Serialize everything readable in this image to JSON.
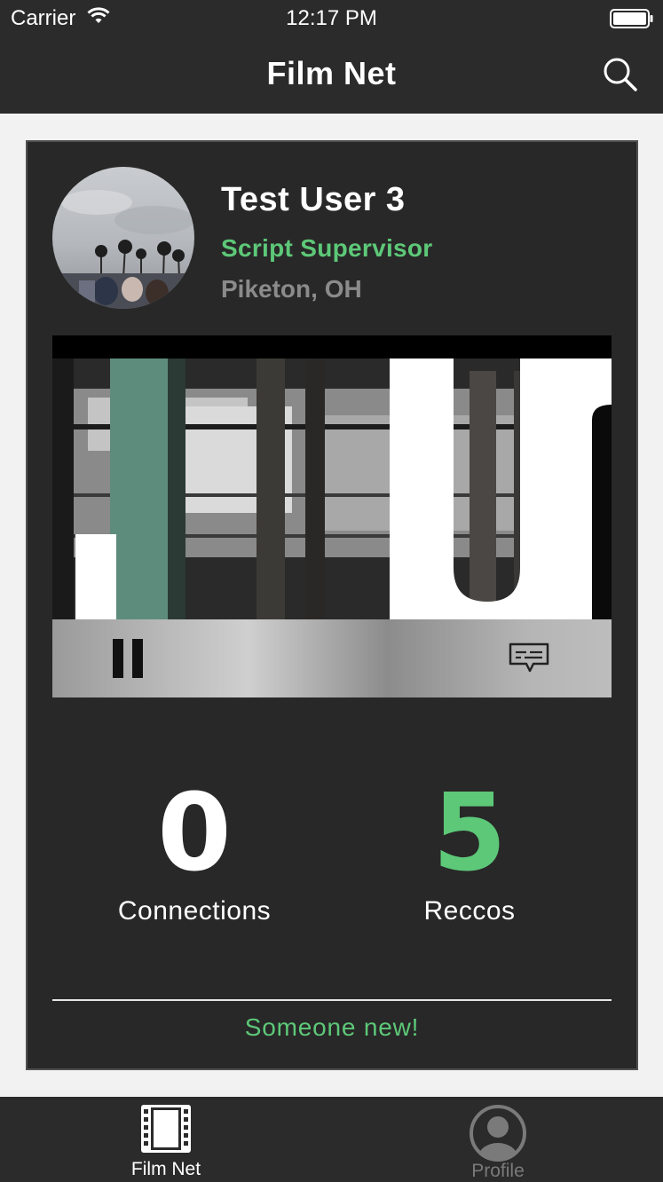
{
  "status_bar": {
    "carrier": "Carrier",
    "time": "12:17 PM"
  },
  "nav": {
    "title": "Film Net",
    "search_icon": "search-icon"
  },
  "profile": {
    "name": "Test User 3",
    "role": "Script Supervisor",
    "location": "Piketon, OH"
  },
  "video": {
    "state": "playing",
    "controls": [
      "pause-icon",
      "closed-captions-icon"
    ]
  },
  "stats": {
    "connections": {
      "value": "0",
      "label": "Connections"
    },
    "reccos": {
      "value": "5",
      "label": "Reccos"
    }
  },
  "action": {
    "someone_new": "Someone new!"
  },
  "tabs": [
    {
      "label": "Film Net",
      "icon": "film-strip-icon",
      "active": true
    },
    {
      "label": "Profile",
      "icon": "profile-icon",
      "active": false
    }
  ],
  "colors": {
    "accent": "#5dc878",
    "bar": "#2b2b2b",
    "card": "#282828",
    "inactive": "#7a7a7a"
  }
}
